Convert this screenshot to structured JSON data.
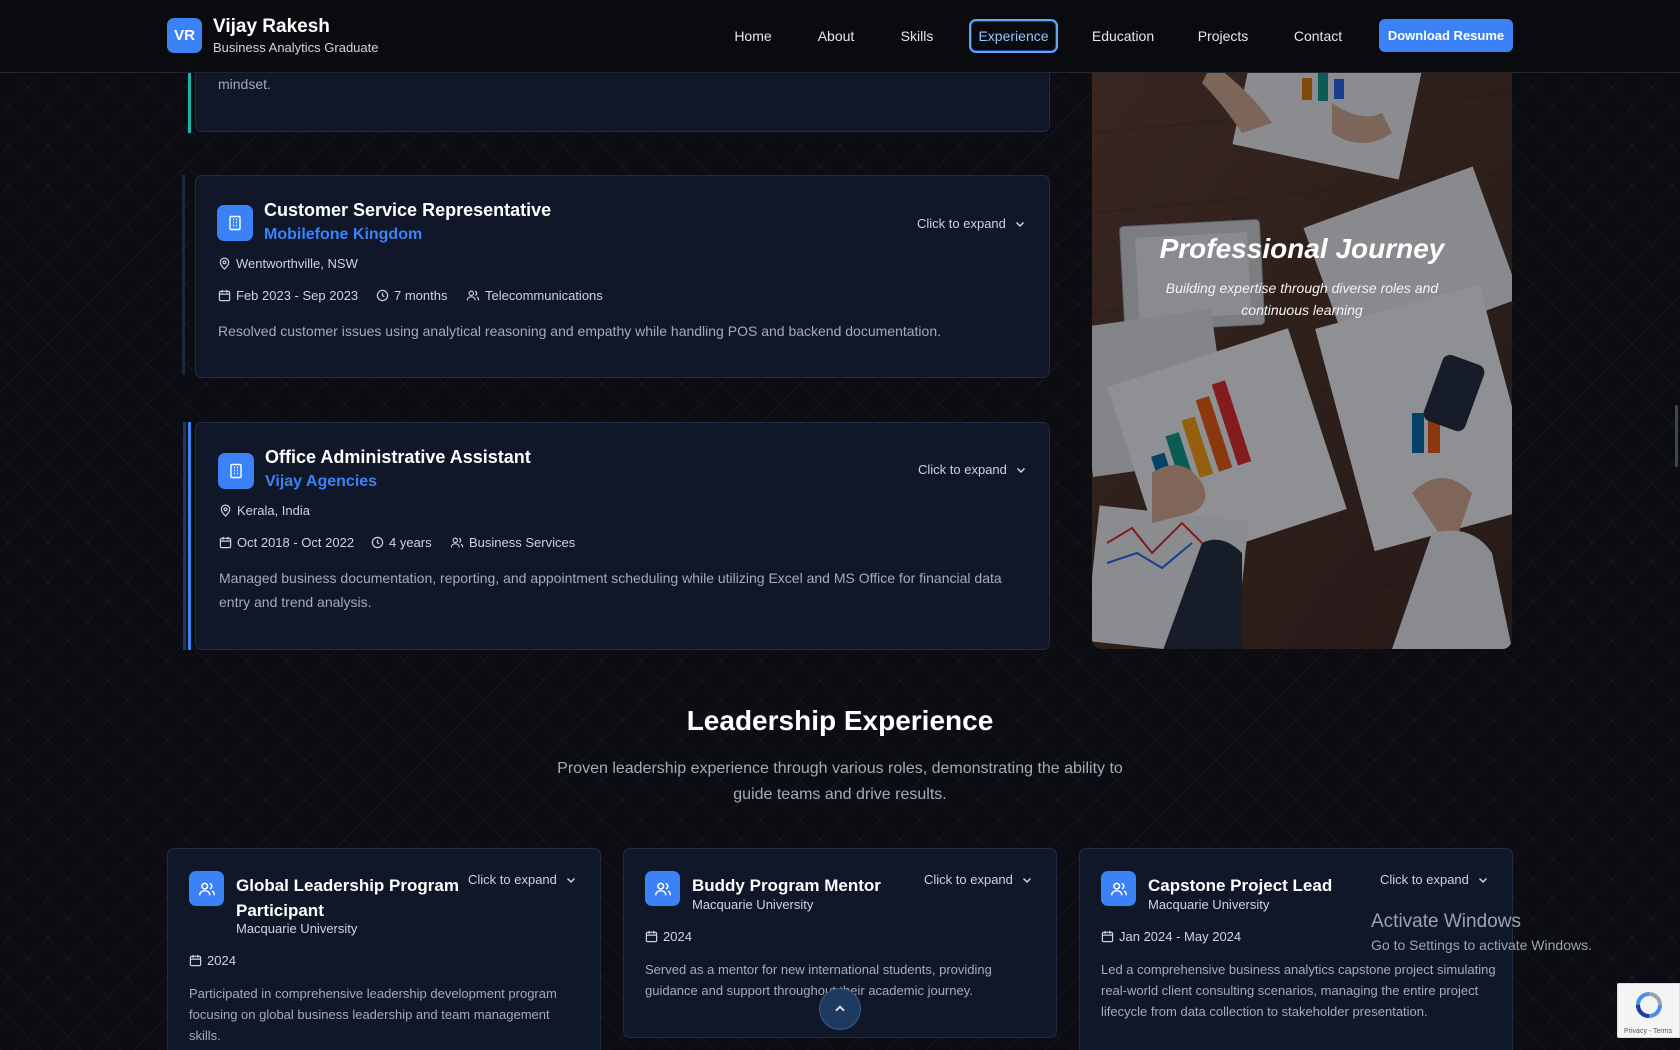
{
  "header": {
    "logo": "VR",
    "name": "Vijay Rakesh",
    "subtitle": "Business Analytics Graduate",
    "nav": [
      "Home",
      "About",
      "Skills",
      "Experience",
      "Education",
      "Projects",
      "Contact"
    ],
    "active_nav": "Experience",
    "download": "Download Resume"
  },
  "experience": {
    "prev_card_tail": "mindset.",
    "expand_label": "Click to expand",
    "items": [
      {
        "title": "Customer Service Representative",
        "company": "Mobilefone Kingdom",
        "location": "Wentworthville, NSW",
        "dates": "Feb 2023 - Sep 2023",
        "duration": "7 months",
        "industry": "Telecommunications",
        "description": "Resolved customer issues using analytical reasoning and empathy while handling POS and backend documentation."
      },
      {
        "title": "Office Administrative Assistant",
        "company": "Vijay Agencies",
        "location": "Kerala, India",
        "dates": "Oct 2018 - Oct 2022",
        "duration": "4 years",
        "industry": "Business Services",
        "description_line1": "Managed business documentation, reporting, and appointment scheduling while utilizing Excel and MS Office for financial data",
        "description_line2": "entry and trend analysis."
      }
    ]
  },
  "journey": {
    "title": "Professional Journey",
    "subtitle": "Building expertise through diverse roles and continuous learning"
  },
  "leadership": {
    "heading": "Leadership Experience",
    "subheading": "Proven leadership experience through various roles, demonstrating the ability to guide teams and drive results.",
    "expand_label": "Click to expand",
    "cards": [
      {
        "title_line1": "Global Leadership Program",
        "title_line2": "Participant",
        "org": "Macquarie University",
        "date": "2024",
        "desc": "Participated in comprehensive leadership development program focusing on global business leadership and team management skills."
      },
      {
        "title_line1": "Buddy Program Mentor",
        "title_line2": "",
        "org": "Macquarie University",
        "date": "2024",
        "desc": "Served as a mentor for new international students, providing guidance and support throughout their academic journey."
      },
      {
        "title_line1": "Capstone Project Lead",
        "title_line2": "",
        "org": "Macquarie University",
        "date": "Jan 2024 - May 2024",
        "desc": "Led a comprehensive business analytics capstone project simulating real-world client consulting scenarios, managing the entire project lifecycle from data collection to stakeholder presentation."
      }
    ]
  },
  "os_overlay": {
    "activate_title": "Activate Windows",
    "activate_sub": "Go to Settings to activate Windows.",
    "recaptcha_links": "Privacy - Terms"
  },
  "colors": {
    "accent": "#3b82f6",
    "background": "#0b0d12",
    "card": "#0f1729",
    "timeline_teal": "#14b8a6"
  }
}
